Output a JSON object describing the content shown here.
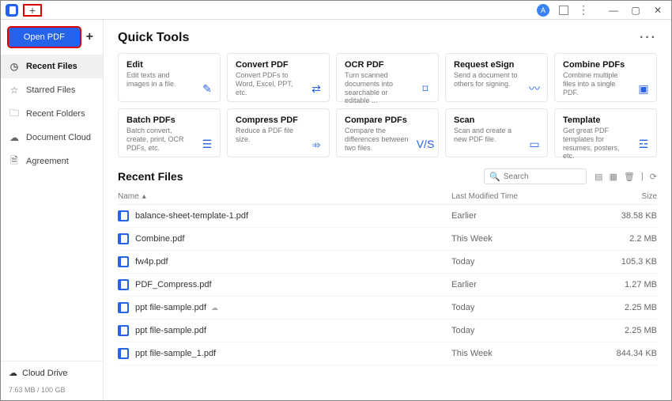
{
  "titlebar": {
    "tab_plus": "+",
    "account_initial": "A"
  },
  "sidebar": {
    "open_pdf": "Open PDF",
    "nav": [
      {
        "icon": "clock-icon",
        "label": "Recent Files",
        "active": true
      },
      {
        "icon": "star-icon",
        "label": "Starred Files",
        "active": false
      },
      {
        "icon": "folder-icon",
        "label": "Recent Folders",
        "active": false
      },
      {
        "icon": "cloud-icon",
        "label": "Document Cloud",
        "active": false
      },
      {
        "icon": "file-icon",
        "label": "Agreement",
        "active": false
      }
    ],
    "cloud_drive": "Cloud Drive",
    "storage": "7.63 MB / 100 GB"
  },
  "main": {
    "quick_tools_title": "Quick Tools",
    "tools": [
      {
        "title": "Edit",
        "desc": "Edit texts and images in a file.",
        "icon": "edit-icon"
      },
      {
        "title": "Convert PDF",
        "desc": "Convert PDFs to Word, Excel, PPT, etc.",
        "icon": "convert-icon"
      },
      {
        "title": "OCR PDF",
        "desc": "Turn scanned documents into searchable or editable ...",
        "icon": "ocr-icon"
      },
      {
        "title": "Request eSign",
        "desc": "Send a document to others for signing.",
        "icon": "esign-icon"
      },
      {
        "title": "Combine PDFs",
        "desc": "Combine multiple files into a single PDF.",
        "icon": "combine-icon"
      },
      {
        "title": "Batch PDFs",
        "desc": "Batch convert, create, print, OCR PDFs, etc.",
        "icon": "batch-icon"
      },
      {
        "title": "Compress PDF",
        "desc": "Reduce a PDF file size.",
        "icon": "compress-icon"
      },
      {
        "title": "Compare PDFs",
        "desc": "Compare the differences between two files.",
        "icon": "compare-icon"
      },
      {
        "title": "Scan",
        "desc": "Scan and create a new PDF file.",
        "icon": "scan-icon"
      },
      {
        "title": "Template",
        "desc": "Get great PDF templates for resumes, posters, etc.",
        "icon": "template-icon"
      }
    ],
    "recent_title": "Recent Files",
    "search_placeholder": "Search",
    "columns": {
      "name": "Name",
      "modified": "Last Modified Time",
      "size": "Size"
    },
    "files": [
      {
        "name": "balance-sheet-template-1.pdf",
        "modified": "Earlier",
        "size": "38.58 KB",
        "cloud": false
      },
      {
        "name": "Combine.pdf",
        "modified": "This Week",
        "size": "2.2 MB",
        "cloud": false
      },
      {
        "name": "fw4p.pdf",
        "modified": "Today",
        "size": "105.3 KB",
        "cloud": false
      },
      {
        "name": "PDF_Compress.pdf",
        "modified": "Earlier",
        "size": "1.27 MB",
        "cloud": false
      },
      {
        "name": "ppt file-sample.pdf",
        "modified": "Today",
        "size": "2.25 MB",
        "cloud": true
      },
      {
        "name": "ppt file-sample.pdf",
        "modified": "Today",
        "size": "2.25 MB",
        "cloud": false
      },
      {
        "name": "ppt file-sample_1.pdf",
        "modified": "This Week",
        "size": "844.34 KB",
        "cloud": false
      }
    ]
  },
  "icons": {
    "edit-icon": "✎",
    "convert-icon": "⇄",
    "ocr-icon": "⌑",
    "esign-icon": "〰",
    "combine-icon": "▣",
    "batch-icon": "☰",
    "compress-icon": "⤃",
    "compare-icon": "V/S",
    "scan-icon": "▭",
    "template-icon": "☲"
  }
}
